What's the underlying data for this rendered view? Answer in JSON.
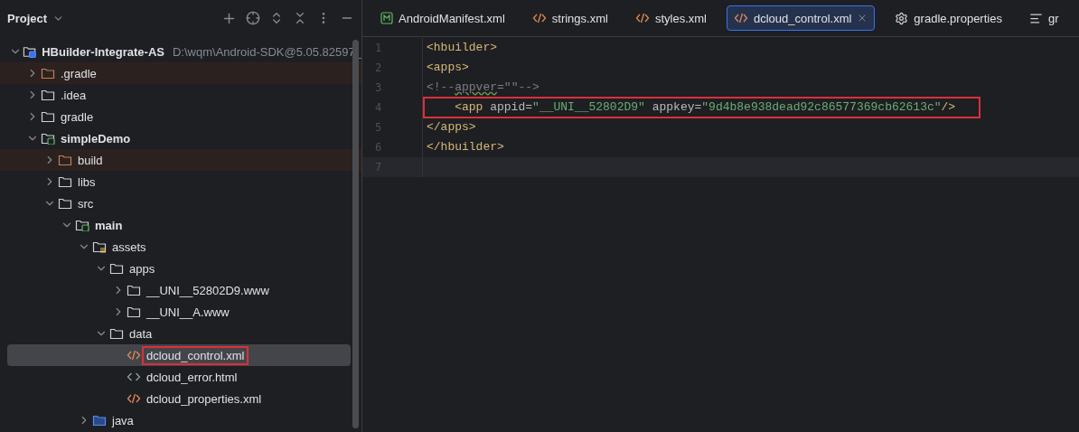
{
  "project_panel": {
    "title": "Project",
    "tree": [
      {
        "name": "HBuilder-Integrate-AS",
        "path": "D:\\wqm\\Android-SDK@5.05.82597_",
        "kind": "project",
        "expanded": true,
        "bold": true,
        "children": [
          {
            "name": ".gradle",
            "kind": "folder",
            "expanded": false,
            "excluded": true
          },
          {
            "name": ".idea",
            "kind": "folder",
            "expanded": false
          },
          {
            "name": "gradle",
            "kind": "folder",
            "expanded": false
          },
          {
            "name": "simpleDemo",
            "kind": "module",
            "expanded": true,
            "bold": true,
            "children": [
              {
                "name": "build",
                "kind": "folder",
                "expanded": false,
                "excluded": true
              },
              {
                "name": "libs",
                "kind": "folder",
                "expanded": false
              },
              {
                "name": "src",
                "kind": "folder",
                "expanded": true,
                "children": [
                  {
                    "name": "main",
                    "kind": "module",
                    "expanded": true,
                    "bold": true,
                    "children": [
                      {
                        "name": "assets",
                        "kind": "resources",
                        "expanded": true,
                        "children": [
                          {
                            "name": "apps",
                            "kind": "folder",
                            "expanded": true,
                            "children": [
                              {
                                "name": "__UNI__52802D9.www",
                                "kind": "folder",
                                "expanded": false
                              },
                              {
                                "name": "__UNI__A.www",
                                "kind": "folder",
                                "expanded": false
                              }
                            ]
                          },
                          {
                            "name": "data",
                            "kind": "folder",
                            "expanded": true,
                            "children": [
                              {
                                "name": "dcloud_control.xml",
                                "kind": "xml",
                                "selected": true,
                                "boxed": true
                              },
                              {
                                "name": "dcloud_error.html",
                                "kind": "html",
                                "selected": false
                              },
                              {
                                "name": "dcloud_properties.xml",
                                "kind": "xml",
                                "selected": false
                              }
                            ]
                          }
                        ]
                      },
                      {
                        "name": "java",
                        "kind": "source",
                        "expanded": false
                      }
                    ]
                  }
                ]
              }
            ]
          }
        ]
      }
    ]
  },
  "editor": {
    "tabs": [
      {
        "label": "AndroidManifest.xml",
        "kind": "manifest",
        "selected": false
      },
      {
        "label": "strings.xml",
        "kind": "xml",
        "selected": false
      },
      {
        "label": "styles.xml",
        "kind": "xml",
        "selected": false
      },
      {
        "label": "dcloud_control.xml",
        "kind": "xml",
        "selected": true
      },
      {
        "label": "gradle.properties",
        "kind": "settings",
        "selected": false
      },
      {
        "label": "gr",
        "kind": "text",
        "selected": false
      }
    ],
    "lines": [
      {
        "number": "1",
        "current": false,
        "tokens": [
          {
            "kind": "tag",
            "text": "<hbuilder>"
          }
        ]
      },
      {
        "number": "2",
        "current": false,
        "tokens": [
          {
            "kind": "tag",
            "text": "<apps>"
          }
        ]
      },
      {
        "number": "3",
        "current": false,
        "tokens": [
          {
            "kind": "comment",
            "text": "<!--"
          },
          {
            "kind": "comment",
            "text": "appver",
            "underline": true
          },
          {
            "kind": "comment",
            "text": "=\"\"-->"
          }
        ]
      },
      {
        "number": "4",
        "boxed": true,
        "current": false,
        "tokens": [
          {
            "kind": "tag",
            "text": "    <app "
          },
          {
            "kind": "attr",
            "text": "appid"
          },
          {
            "kind": "punct",
            "text": "="
          },
          {
            "kind": "string",
            "text": "\"__UNI__52802D9\""
          },
          {
            "kind": "attr",
            "text": " appkey"
          },
          {
            "kind": "punct",
            "text": "="
          },
          {
            "kind": "string",
            "text": "\"9d4b8e938dead92c86577369cb62613c\""
          },
          {
            "kind": "tag",
            "text": "/>"
          }
        ]
      },
      {
        "number": "5",
        "current": false,
        "tokens": [
          {
            "kind": "tag",
            "text": "</apps>"
          }
        ]
      },
      {
        "number": "6",
        "current": false,
        "tokens": [
          {
            "kind": "tag",
            "text": "</hbuilder>"
          }
        ]
      },
      {
        "number": "7",
        "current": true
      }
    ]
  }
}
